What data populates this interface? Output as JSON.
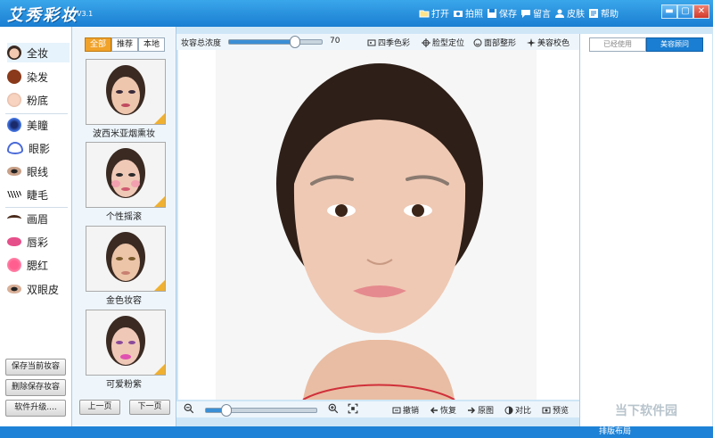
{
  "app": {
    "title": "艾秀彩妆",
    "version": "V3.1"
  },
  "titlebar": {
    "buttons": [
      {
        "label": "打开",
        "icon": "folder-icon"
      },
      {
        "label": "拍照",
        "icon": "camera-icon"
      },
      {
        "label": "保存",
        "icon": "save-icon"
      },
      {
        "label": "留言",
        "icon": "message-icon"
      },
      {
        "label": "皮肤",
        "icon": "skin-icon"
      },
      {
        "label": "帮助",
        "icon": "help-icon"
      }
    ],
    "window_controls": {
      "minimize": "▬",
      "maximize": "▢",
      "close": "✕"
    }
  },
  "sidebar": {
    "categories": [
      {
        "label": "全妆",
        "icon": "face-icon",
        "active": true
      },
      {
        "label": "染发",
        "icon": "hair-icon"
      },
      {
        "label": "粉底",
        "icon": "foundation-icon"
      },
      {
        "label": "美瞳",
        "icon": "eye-pupil-icon"
      },
      {
        "label": "眼影",
        "icon": "eyeshadow-icon"
      },
      {
        "label": "眼线",
        "icon": "eyeliner-icon"
      },
      {
        "label": "睫毛",
        "icon": "eyelash-icon"
      },
      {
        "label": "画眉",
        "icon": "eyebrow-icon"
      },
      {
        "label": "唇彩",
        "icon": "lips-icon"
      },
      {
        "label": "腮红",
        "icon": "blush-icon"
      },
      {
        "label": "双眼皮",
        "icon": "double-eyelid-icon"
      }
    ],
    "buttons": {
      "save_current": "保存当前妆容",
      "delete_saved": "删除保存妆容",
      "upgrade": "软件升级...."
    }
  },
  "filters": {
    "all": "全部",
    "recommended": "推荐",
    "local": "本地"
  },
  "styles": [
    {
      "caption": "波西米亚烟熏妆"
    },
    {
      "caption": "个性摇滚"
    },
    {
      "caption": "金色妆容"
    },
    {
      "caption": "可爱粉紫"
    }
  ],
  "pager": {
    "prev": "上一页",
    "next": "下一页"
  },
  "toolbar": {
    "intensity_label": "妆容总浓度",
    "intensity_value": "70",
    "intensity_fraction": 0.7,
    "items": [
      {
        "label": "四季色彩",
        "icon": "palette-icon"
      },
      {
        "label": "脸型定位",
        "icon": "locate-icon"
      },
      {
        "label": "面部整形",
        "icon": "smile-icon"
      },
      {
        "label": "美容校色",
        "icon": "color-adjust-icon"
      }
    ]
  },
  "bottom_toolbar": {
    "zoom_fraction": 0.18,
    "items": [
      {
        "label": "撤销",
        "icon": "undo-icon"
      },
      {
        "label": "恢复",
        "icon": "redo-icon"
      },
      {
        "label": "原图",
        "icon": "original-icon"
      },
      {
        "label": "对比",
        "icon": "compare-icon"
      },
      {
        "label": "预览",
        "icon": "preview-icon"
      }
    ]
  },
  "right_tabs": {
    "used": "已经使用",
    "consultant": "美容顾问"
  },
  "status": {
    "layout": "排版布局"
  },
  "watermark": "当下软件园",
  "colors": {
    "accent": "#1a7ed2",
    "filter_active": "#f0a22a"
  }
}
